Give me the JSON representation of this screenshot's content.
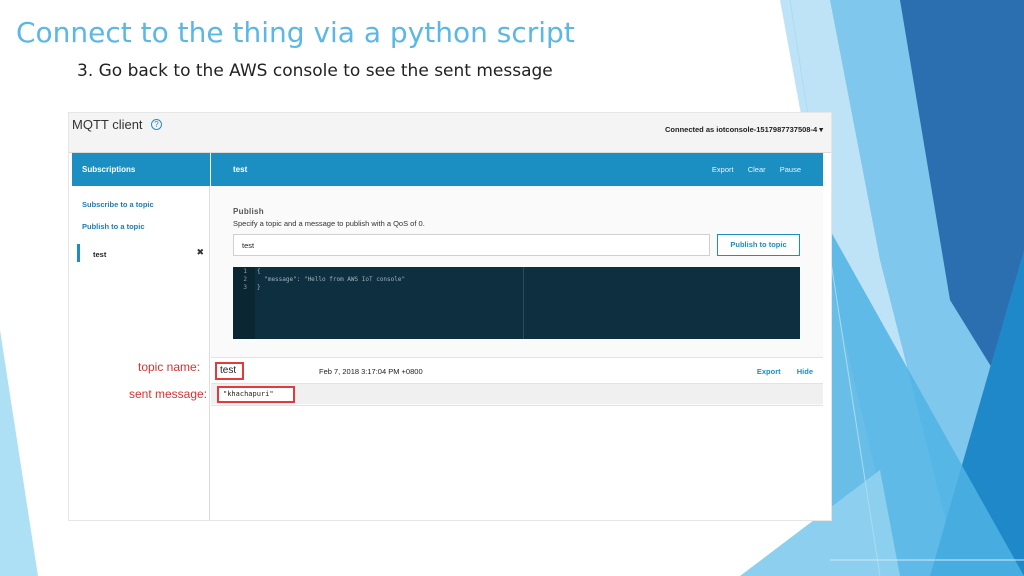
{
  "slide": {
    "title": "Connect to the thing via a python script",
    "subtitle": "3. Go back to the AWS console to see the sent message"
  },
  "mqtt": {
    "title": "MQTT client",
    "help_glyph": "?",
    "connected_text": "Connected as iotconsole-1517987737508-4 ▾"
  },
  "sidebar": {
    "header": "Subscriptions",
    "subscribe_link": "Subscribe to a topic",
    "publish_link": "Publish to a topic",
    "subscription": {
      "topic": "test",
      "close_glyph": "✖"
    }
  },
  "main": {
    "topic": "test",
    "actions": {
      "export": "Export",
      "clear": "Clear",
      "pause": "Pause"
    },
    "publish": {
      "title": "Publish",
      "description": "Specify a topic and a message to publish with a QoS of 0.",
      "topic_value": "test",
      "button": "Publish to topic",
      "line_numbers": [
        "1",
        "2",
        "3"
      ],
      "code_lines": [
        "{",
        "  \"message\": \"Hello from AWS IoT console\"",
        "}"
      ]
    },
    "message": {
      "topic": "test",
      "timestamp": "Feb 7, 2018 3:17:04 PM +0800",
      "export": "Export",
      "hide": "Hide",
      "payload": "\"khachapuri\""
    }
  },
  "annotations": {
    "topic_name": "topic name:",
    "sent_message": "sent message:"
  },
  "colors": {
    "title": "#5bb8e6",
    "header_blue": "#1b8fc2",
    "highlight_red": "#e23b3b"
  }
}
